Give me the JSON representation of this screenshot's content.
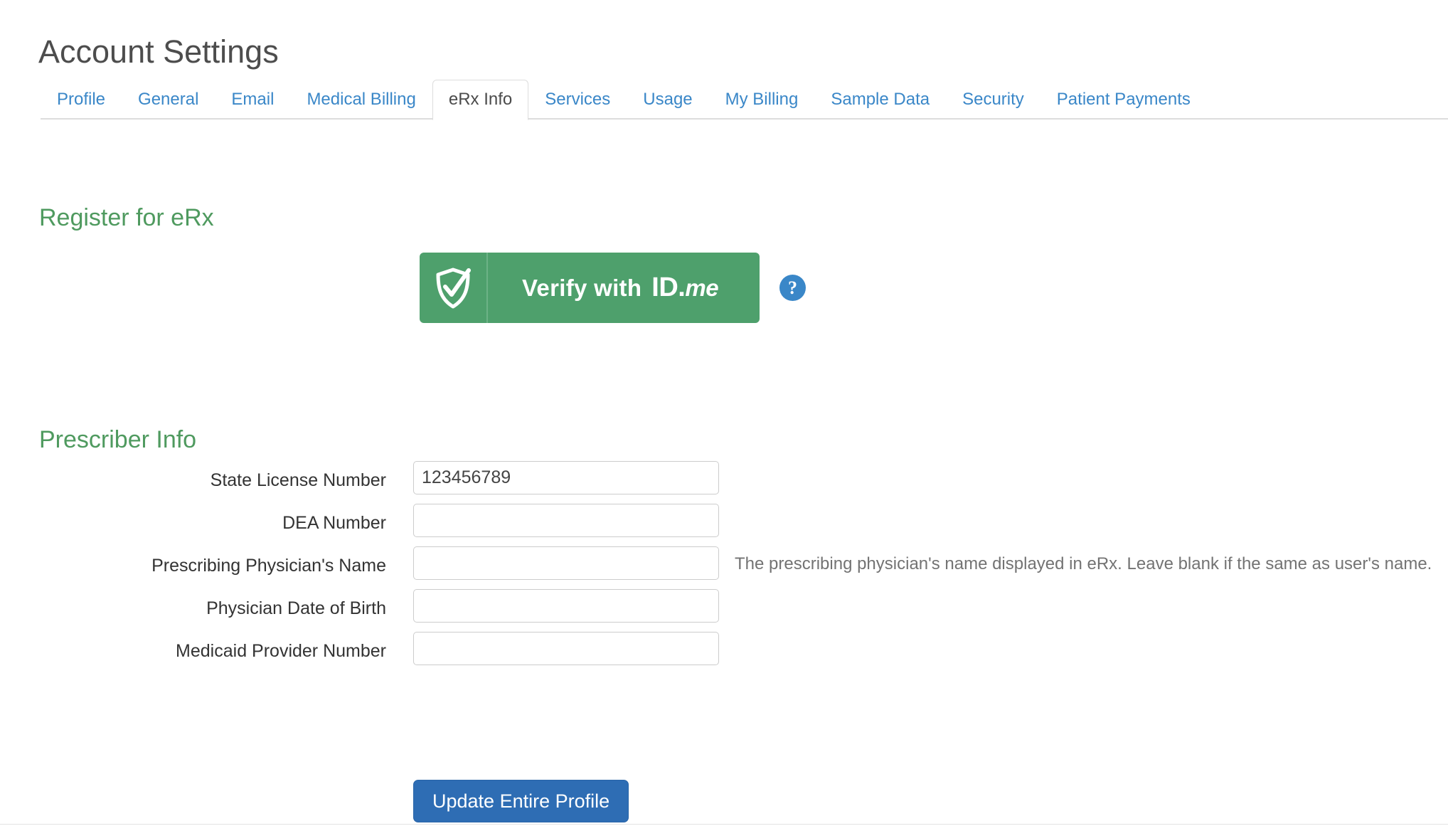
{
  "page": {
    "title": "Account Settings"
  },
  "tabs": [
    {
      "label": "Profile",
      "active": false
    },
    {
      "label": "General",
      "active": false
    },
    {
      "label": "Email",
      "active": false
    },
    {
      "label": "Medical Billing",
      "active": false
    },
    {
      "label": "eRx Info",
      "active": true
    },
    {
      "label": "Services",
      "active": false
    },
    {
      "label": "Usage",
      "active": false
    },
    {
      "label": "My Billing",
      "active": false
    },
    {
      "label": "Sample Data",
      "active": false
    },
    {
      "label": "Security",
      "active": false
    },
    {
      "label": "Patient Payments",
      "active": false
    }
  ],
  "register_section": {
    "heading": "Register for eRx",
    "idme_button": {
      "verify_text": "Verify with",
      "logo_id": "ID.",
      "logo_me": "me",
      "shield_icon": "shield-check-icon"
    },
    "help_icon": {
      "glyph": "?",
      "name": "help-icon"
    }
  },
  "prescriber_section": {
    "heading": "Prescriber Info",
    "fields": [
      {
        "label": "State License Number",
        "value": "123456789",
        "placeholder": "",
        "help": ""
      },
      {
        "label": "DEA Number",
        "value": "",
        "placeholder": "",
        "help": ""
      },
      {
        "label": "Prescribing Physician's Name",
        "value": "",
        "placeholder": "",
        "help": "The prescribing physician's name displayed in eRx. Leave blank if the same as user's name."
      },
      {
        "label": "Physician Date of Birth",
        "value": "",
        "placeholder": "",
        "help": ""
      },
      {
        "label": "Medicaid Provider Number",
        "value": "",
        "placeholder": "",
        "help": ""
      }
    ]
  },
  "actions": {
    "update_label": "Update Entire Profile"
  },
  "colors": {
    "link_blue": "#3a87c8",
    "heading_green": "#4f9a5f",
    "idme_green": "#4ea06c",
    "primary_blue": "#2e6db4",
    "border_gray": "#dddddd"
  }
}
